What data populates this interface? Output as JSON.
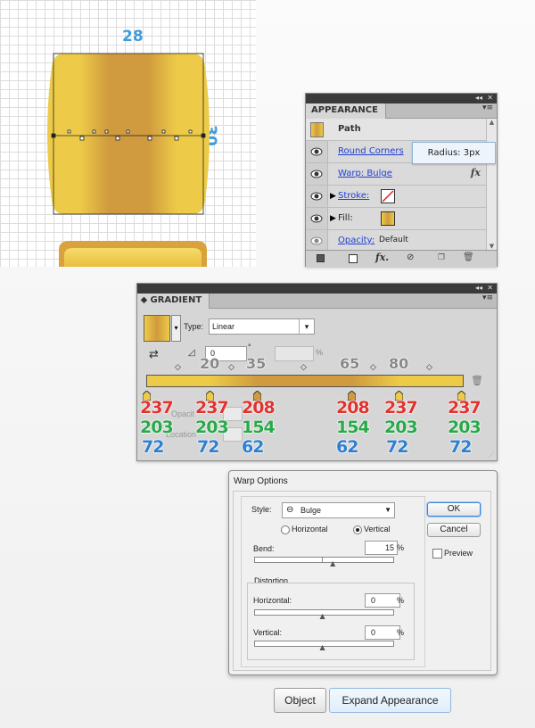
{
  "canvas": {
    "width_label": "28",
    "height_label": "30",
    "colors": {
      "gold_light": "#EDCB48",
      "gold_dark": "#D09A3E"
    }
  },
  "appearance": {
    "title": "APPEARANCE",
    "path_label": "Path",
    "items": [
      {
        "label": "Round Corners"
      },
      {
        "label": "Warp: Bulge"
      },
      {
        "label": "Stroke:"
      },
      {
        "label": "Fill:"
      },
      {
        "label": "Opacity:",
        "value": "Default"
      }
    ],
    "tooltip": "Radius: 3px",
    "fx_label": "fx"
  },
  "gradient": {
    "title": "GRADIENT",
    "type_label": "Type:",
    "type_value": "Linear",
    "angle_value": "0",
    "percent_symbol": "%",
    "degree_symbol": "°",
    "hidden_labels": {
      "opacity": "Opacit",
      "location": "Location"
    },
    "midpoint_labels": [
      "20",
      "35",
      "65",
      "80"
    ],
    "stops": [
      {
        "r": "237",
        "g": "203",
        "b": "72"
      },
      {
        "r": "237",
        "g": "203",
        "b": "72"
      },
      {
        "r": "208",
        "g": "154",
        "b": "62"
      },
      {
        "r": "208",
        "g": "154",
        "b": "62"
      },
      {
        "r": "237",
        "g": "203",
        "b": "72"
      },
      {
        "r": "237",
        "g": "203",
        "b": "72"
      }
    ]
  },
  "warp": {
    "title": "Warp Options",
    "style_label": "Style:",
    "style_value": "Bulge",
    "horizontal_label": "Horizontal",
    "vertical_label": "Vertical",
    "orientation_selected": "Vertical",
    "bend_label": "Bend:",
    "bend_value": "15",
    "percent": "%",
    "distortion_label": "Distortion",
    "dist_horizontal_label": "Horizontal:",
    "dist_horizontal_value": "0",
    "dist_vertical_label": "Vertical:",
    "dist_vertical_value": "0",
    "ok_label": "OK",
    "cancel_label": "Cancel",
    "preview_label": "Preview",
    "bend_fraction": 0.15,
    "dist_h_fraction": 0.0,
    "dist_v_fraction": 0.0
  },
  "menu": {
    "object_label": "Object",
    "expand_label": "Expand Appearance"
  }
}
